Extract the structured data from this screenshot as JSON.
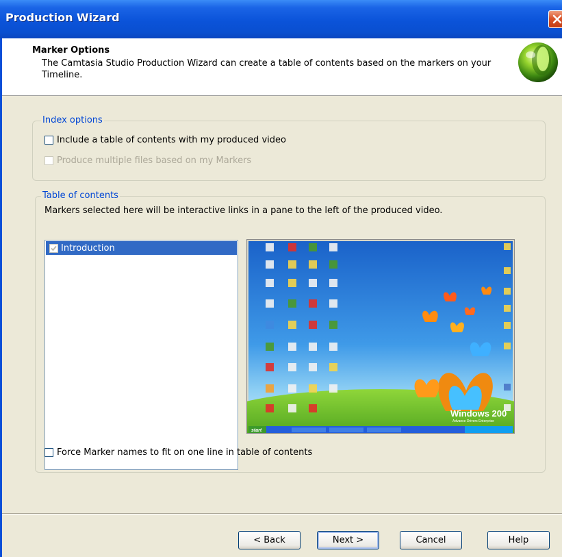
{
  "window": {
    "title": "Production Wizard"
  },
  "header": {
    "title": "Marker Options",
    "description": "The Camtasia Studio Production Wizard can create a table of contents based on the markers on your Timeline."
  },
  "index_options": {
    "legend": "Index options",
    "include_toc": {
      "label": "Include a table of contents with my produced video",
      "checked": false
    },
    "multiple_files": {
      "label": "Produce multiple files based on my Markers",
      "checked": false,
      "enabled": false
    }
  },
  "toc": {
    "legend": "Table of contents",
    "description": "Markers selected here will be interactive links in a pane to the left of the produced video.",
    "markers": [
      {
        "label": "Introduction",
        "checked": true,
        "selected": true
      }
    ],
    "preview": {
      "watermark": "Windows 200",
      "watermark_sub": "Advance Drivers Enterprise",
      "taskbar_start": "start"
    },
    "force_one_line": {
      "label": "Force Marker names to fit on one line in table of contents",
      "checked": false
    }
  },
  "buttons": {
    "back": "< Back",
    "next": "Next >",
    "cancel": "Cancel",
    "help": "Help"
  },
  "icons": {
    "close": "close-icon",
    "logo": "camtasia-logo-icon",
    "check": "checkmark-icon"
  },
  "colors": {
    "titlebar": "#0a4fd8",
    "legend": "#0046d5",
    "selection": "#316ac5",
    "dialog_bg": "#ece9d8"
  }
}
